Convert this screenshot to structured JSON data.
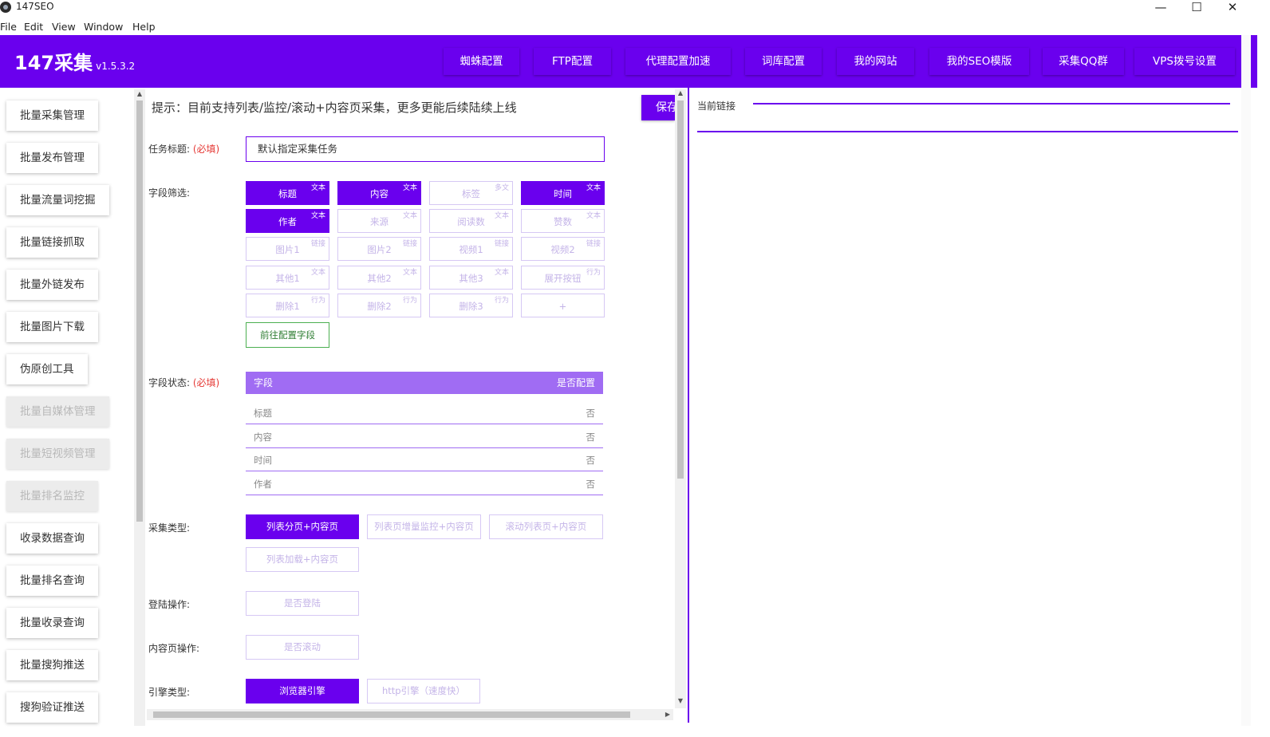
{
  "window": {
    "title": "147SEO",
    "controls": {
      "minimize": "—",
      "maximize": "☐",
      "close": "✕"
    }
  },
  "menu": [
    "File",
    "Edit",
    "View",
    "Window",
    "Help"
  ],
  "header": {
    "brand": "147采集",
    "version": "v1.5.3.2",
    "nav": [
      "蜘蛛配置",
      "FTP配置",
      "代理配置加速",
      "词库配置",
      "我的网站",
      "我的SEO模版",
      "采集QQ群",
      "VPS拨号设置"
    ]
  },
  "sidebar": {
    "items": [
      {
        "label": "批量采集管理",
        "disabled": false
      },
      {
        "label": "批量发布管理",
        "disabled": false
      },
      {
        "label": "批量流量词挖掘",
        "disabled": false
      },
      {
        "label": "批量链接抓取",
        "disabled": false
      },
      {
        "label": "批量外链发布",
        "disabled": false
      },
      {
        "label": "批量图片下载",
        "disabled": false
      },
      {
        "label": "伪原创工具",
        "disabled": false
      },
      {
        "label": "批量自媒体管理",
        "disabled": true
      },
      {
        "label": "批量短视频管理",
        "disabled": true
      },
      {
        "label": "批量排名监控",
        "disabled": true
      },
      {
        "label": "收录数据查询",
        "disabled": false
      },
      {
        "label": "批量排名查询",
        "disabled": false
      },
      {
        "label": "批量收录查询",
        "disabled": false
      },
      {
        "label": "批量搜狗推送",
        "disabled": false
      },
      {
        "label": "搜狗验证推送",
        "disabled": false
      }
    ]
  },
  "form": {
    "hint": "提示：目前支持列表/监控/滚动+内容页采集，更多更能后续陆续上线",
    "save_label": "保存",
    "task_title_label": "任务标题:",
    "required_mark": "(必填)",
    "task_title_value": "默认指定采集任务",
    "field_filter_label": "字段筛选:",
    "fields": [
      {
        "name": "标题",
        "tag": "文本",
        "selected": true
      },
      {
        "name": "内容",
        "tag": "文本",
        "selected": true
      },
      {
        "name": "标签",
        "tag": "多文",
        "selected": false
      },
      {
        "name": "时间",
        "tag": "文本",
        "selected": true
      },
      {
        "name": "作者",
        "tag": "文本",
        "selected": true
      },
      {
        "name": "来源",
        "tag": "文本",
        "selected": false
      },
      {
        "name": "阅读数",
        "tag": "文本",
        "selected": false
      },
      {
        "name": "赞数",
        "tag": "文本",
        "selected": false
      },
      {
        "name": "图片1",
        "tag": "链接",
        "selected": false
      },
      {
        "name": "图片2",
        "tag": "链接",
        "selected": false
      },
      {
        "name": "视频1",
        "tag": "链接",
        "selected": false
      },
      {
        "name": "视频2",
        "tag": "链接",
        "selected": false
      },
      {
        "name": "其他1",
        "tag": "文本",
        "selected": false
      },
      {
        "name": "其他2",
        "tag": "文本",
        "selected": false
      },
      {
        "name": "其他3",
        "tag": "文本",
        "selected": false
      },
      {
        "name": "展开按钮",
        "tag": "行为",
        "selected": false
      },
      {
        "name": "删除1",
        "tag": "行为",
        "selected": false
      },
      {
        "name": "删除2",
        "tag": "行为",
        "selected": false
      },
      {
        "name": "删除3",
        "tag": "行为",
        "selected": false
      },
      {
        "name": "+",
        "tag": "",
        "selected": false
      }
    ],
    "goto_config_label": "前往配置字段",
    "field_status_label": "字段状态:",
    "status_header": {
      "field": "字段",
      "configured": "是否配置"
    },
    "status_rows": [
      {
        "field": "标题",
        "configured": "否"
      },
      {
        "field": "内容",
        "configured": "否"
      },
      {
        "field": "时间",
        "configured": "否"
      },
      {
        "field": "作者",
        "configured": "否"
      }
    ],
    "collect_type_label": "采集类型:",
    "collect_types": [
      {
        "label": "列表分页+内容页",
        "selected": true
      },
      {
        "label": "列表页增量监控+内容页",
        "selected": false
      },
      {
        "label": "滚动列表页+内容页",
        "selected": false
      },
      {
        "label": "列表加载+内容页",
        "selected": false
      }
    ],
    "login_label": "登陆操作:",
    "login_option": "是否登陆",
    "content_op_label": "内容页操作:",
    "content_op_option": "是否滚动",
    "engine_label": "引擎类型:",
    "engines": [
      {
        "label": "浏览器引擎",
        "selected": true
      },
      {
        "label": "http引擎（速度快）",
        "selected": false
      }
    ]
  },
  "right_panel": {
    "current_link_label": "当前链接"
  },
  "colors": {
    "accent": "#6a00ee",
    "accent_light": "#a06cf3",
    "required": "#e53935",
    "go_green": "#4caf50"
  }
}
